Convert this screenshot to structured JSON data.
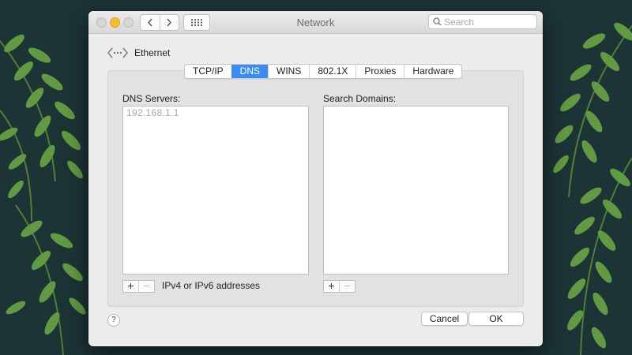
{
  "window": {
    "title": "Network",
    "search_placeholder": "Search"
  },
  "colors": {
    "accent": "#3b8cf0",
    "wallpaper": "#1f3a3c",
    "leaf": "#5f9440"
  },
  "interface": {
    "name": "Ethernet",
    "icon": "ethernet-icon"
  },
  "tabs": [
    {
      "label": "TCP/IP",
      "active": false
    },
    {
      "label": "DNS",
      "active": true
    },
    {
      "label": "WINS",
      "active": false
    },
    {
      "label": "802.1X",
      "active": false
    },
    {
      "label": "Proxies",
      "active": false
    },
    {
      "label": "Hardware",
      "active": false
    }
  ],
  "dns_servers": {
    "label": "DNS Servers:",
    "entries": [
      "192.168.1.1"
    ],
    "add_label": "+",
    "remove_label": "−",
    "hint": "IPv4 or IPv6 addresses"
  },
  "search_domains": {
    "label": "Search Domains:",
    "entries": [],
    "add_label": "+",
    "remove_label": "−"
  },
  "footer": {
    "help_label": "?",
    "cancel_label": "Cancel",
    "ok_label": "OK"
  }
}
